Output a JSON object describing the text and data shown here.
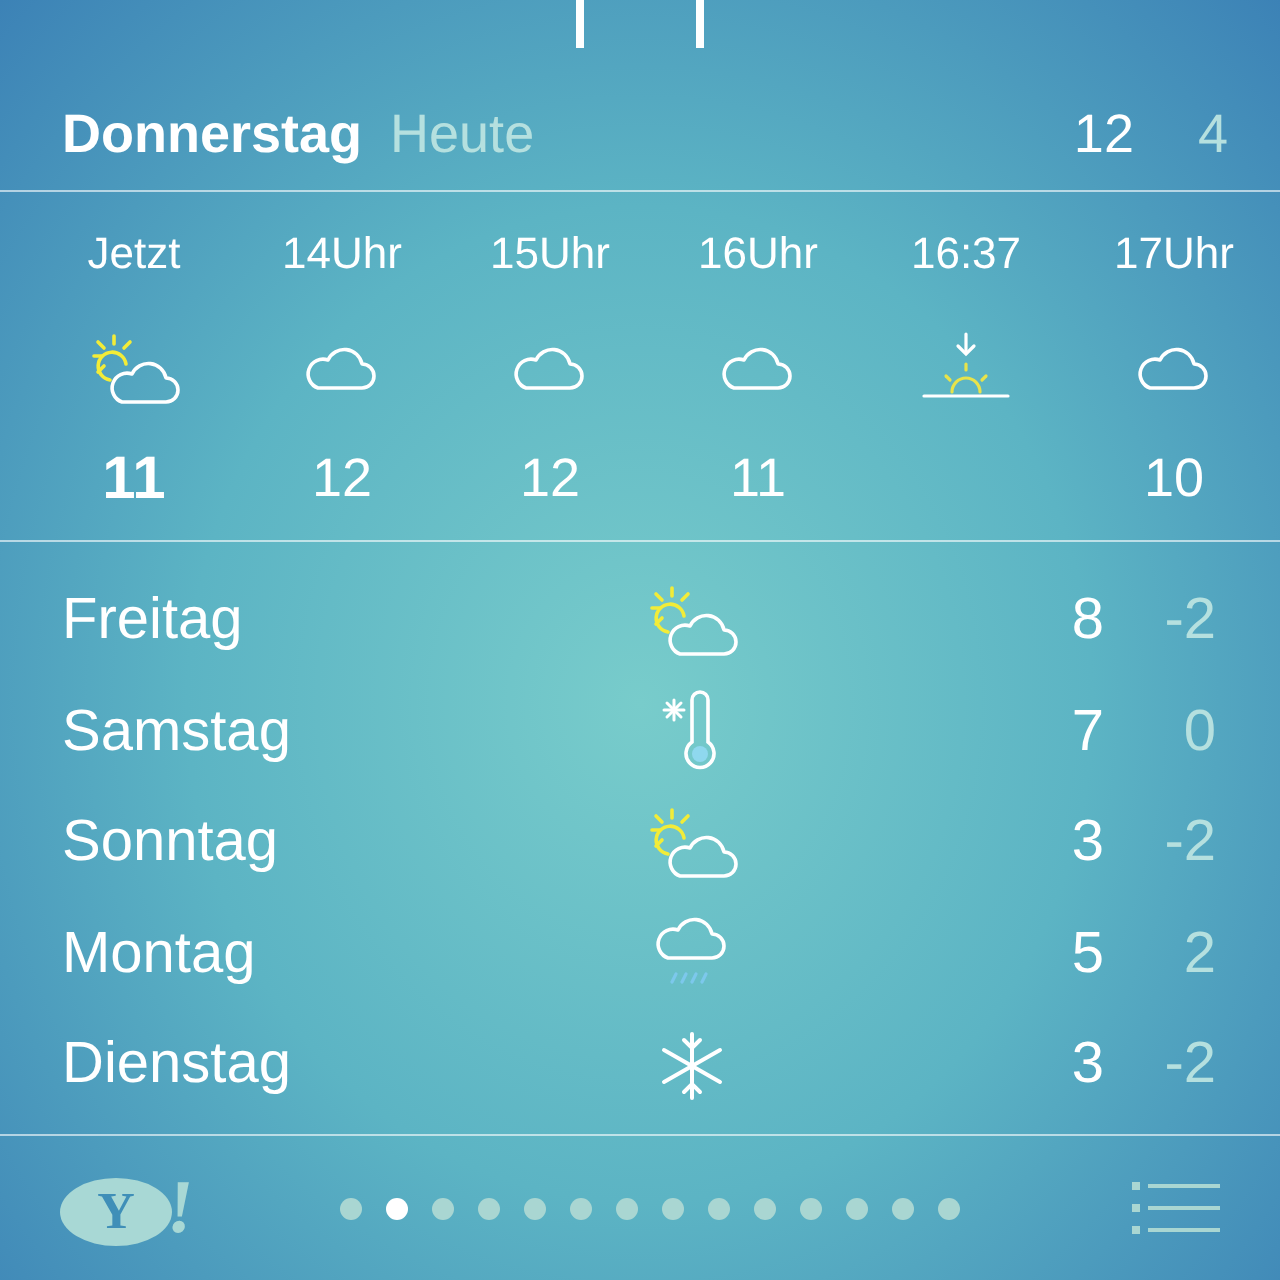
{
  "today": {
    "day": "Donnerstag",
    "label": "Heute",
    "high": "12",
    "low": "4"
  },
  "hourly": [
    {
      "time": "Jetzt",
      "kind": "partly-sunny",
      "temp": "11",
      "current": true
    },
    {
      "time": "14Uhr",
      "kind": "cloudy",
      "temp": "12",
      "current": false
    },
    {
      "time": "15Uhr",
      "kind": "cloudy",
      "temp": "12",
      "current": false
    },
    {
      "time": "16Uhr",
      "kind": "cloudy",
      "temp": "11",
      "current": false
    },
    {
      "time": "16:37",
      "kind": "sunset"
    },
    {
      "time": "17Uhr",
      "kind": "cloudy",
      "temp": "10",
      "current": false
    }
  ],
  "daily": [
    {
      "day": "Freitag",
      "kind": "partly-sunny",
      "high": "8",
      "low": "-2"
    },
    {
      "day": "Samstag",
      "kind": "frost",
      "high": "7",
      "low": "0"
    },
    {
      "day": "Sonntag",
      "kind": "partly-sunny",
      "high": "3",
      "low": "-2"
    },
    {
      "day": "Montag",
      "kind": "rain",
      "high": "5",
      "low": "2"
    },
    {
      "day": "Dienstag",
      "kind": "snow",
      "high": "3",
      "low": "-2"
    }
  ],
  "footer": {
    "logo": {
      "letter": "Y",
      "mark": "!"
    },
    "pages": [
      {
        "selected": false
      },
      {
        "selected": true
      },
      {
        "selected": false
      },
      {
        "selected": false
      },
      {
        "selected": false
      },
      {
        "selected": false
      },
      {
        "selected": false
      },
      {
        "selected": false
      },
      {
        "selected": false
      },
      {
        "selected": false
      },
      {
        "selected": false
      },
      {
        "selected": false
      },
      {
        "selected": false
      },
      {
        "selected": false
      }
    ]
  }
}
